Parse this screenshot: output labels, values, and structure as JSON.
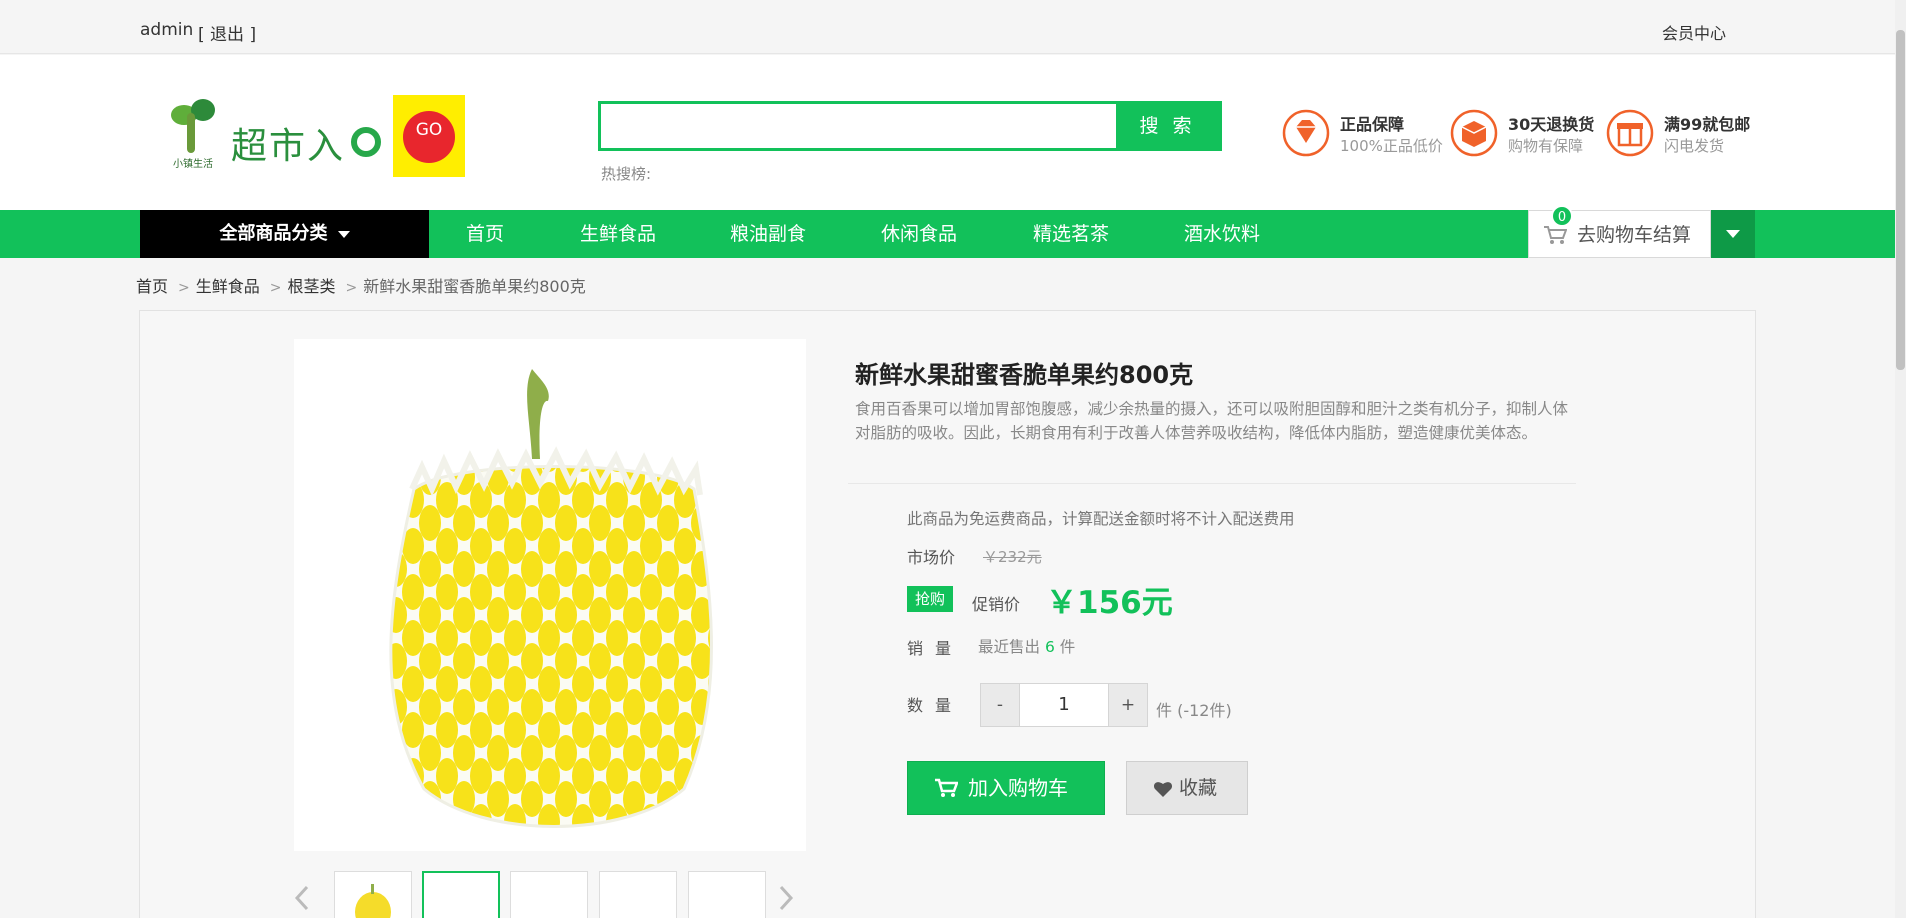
{
  "topbar": {
    "username": "admin",
    "logout_label": "[ 退出 ]",
    "member_center": "会员中心"
  },
  "logo": {
    "brand_small": "小镇生活",
    "name": "超市入",
    "go_badge": "GO"
  },
  "search": {
    "value": "",
    "placeholder": "",
    "button_label": "搜 索",
    "hot_label": "热搜榜:"
  },
  "promises": [
    {
      "title": "正品保障",
      "subtitle": "100%正品低价",
      "icon": "diamond-icon"
    },
    {
      "title": "30天退换货",
      "subtitle": "购物有保障",
      "icon": "box-icon"
    },
    {
      "title": "满99就包邮",
      "subtitle": "闪电发货",
      "icon": "gift-icon"
    }
  ],
  "nav": {
    "all_categories": "全部商品分类",
    "items": [
      "首页",
      "生鲜食品",
      "粮油副食",
      "休闲食品",
      "精选茗茶",
      "酒水饮料"
    ],
    "cart_label": "去购物车结算",
    "cart_count": "0"
  },
  "breadcrumb": [
    "首页",
    "生鲜食品",
    "根茎类",
    "新鲜水果甜蜜香脆单果约800克"
  ],
  "product": {
    "title": "新鲜水果甜蜜香脆单果约800克",
    "description": "食用百香果可以增加胃部饱腹感，减少余热量的摄入，还可以吸附胆固醇和胆汁之类有机分子，抑制人体对脂肪的吸收。因此，长期食用有利于改善人体营养吸收结构，降低体内脂肪，塑造健康优美体态。",
    "free_shipping_note": "此商品为免运费商品，计算配送金额时将不计入配送费用",
    "market_price_label": "市场价",
    "market_price": "￥232元",
    "rush_badge": "抢购",
    "promo_price_label": "促销价",
    "promo_price": "￥156元",
    "sales_label": "销量",
    "sales_prefix": "最近售出",
    "sales_count": "6",
    "sales_unit": "件",
    "qty_label": "数量",
    "qty_minus": "-",
    "qty_value": "1",
    "qty_plus": "+",
    "qty_unit": "件  (-12件)",
    "add_to_cart": "加入购物车",
    "favorite": "收藏"
  },
  "colors": {
    "accent": "#12c15a",
    "nav_dark": "#000000",
    "promise_orange": "#f0622a"
  }
}
